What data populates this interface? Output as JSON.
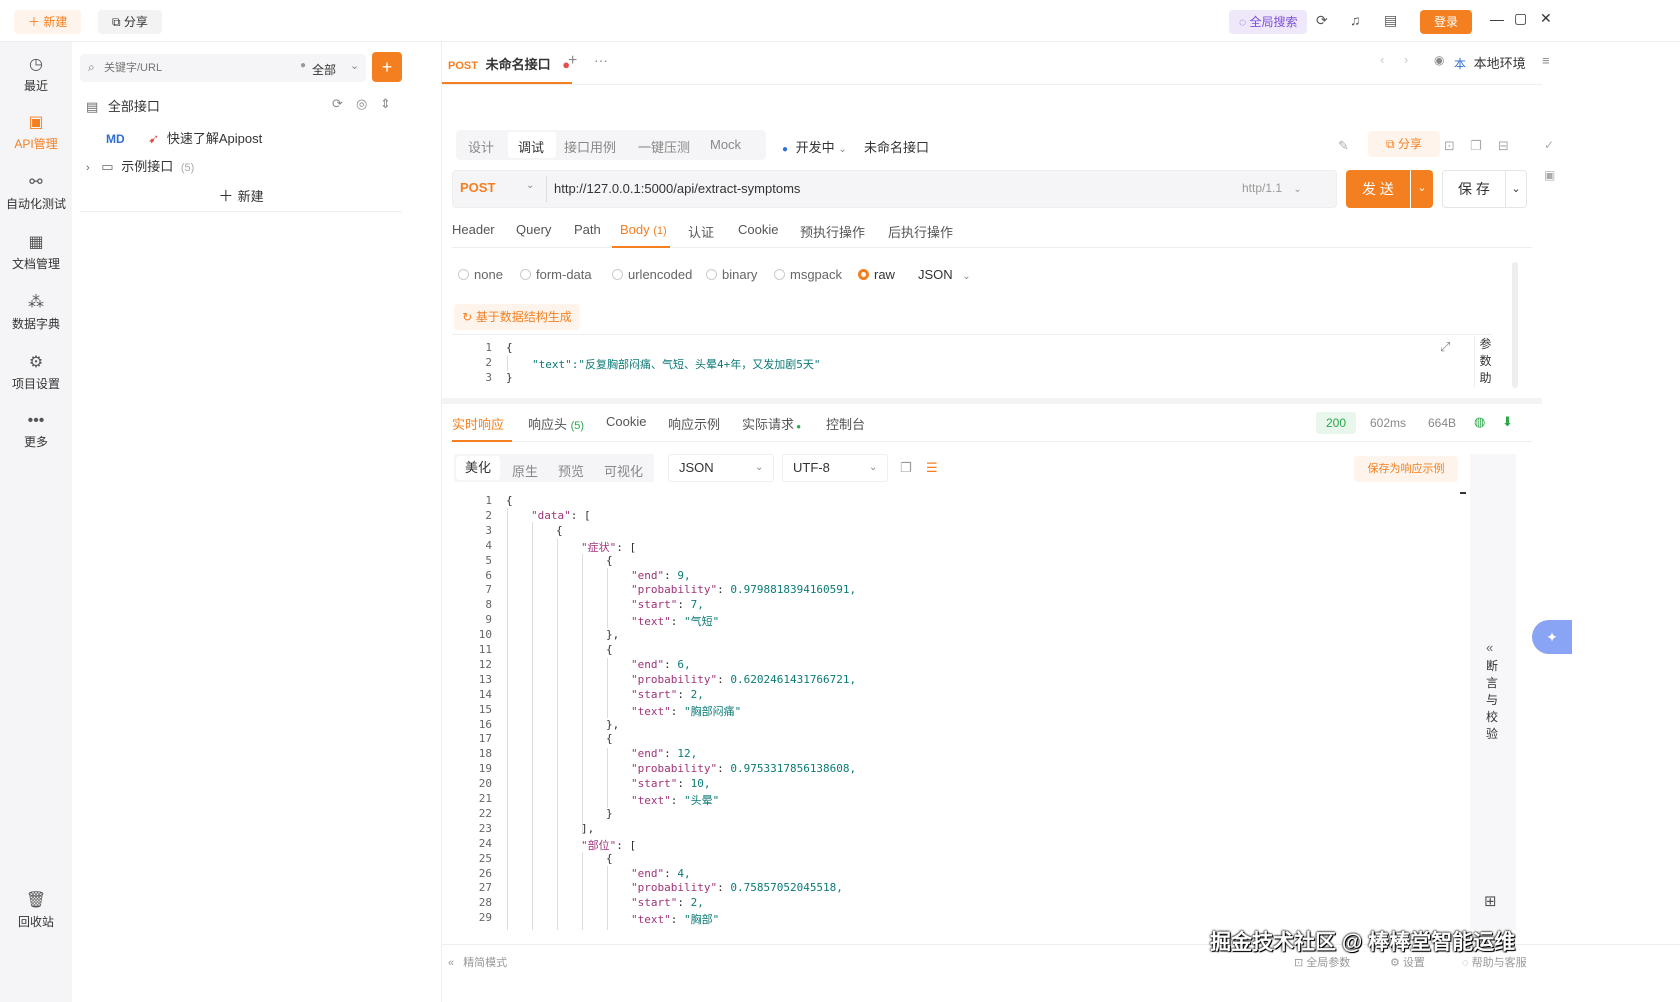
{
  "topbar": {
    "new": "新建",
    "share": "分享",
    "global_search": "全局搜索",
    "login": "登录"
  },
  "nav": {
    "items": [
      "最近",
      "API管理",
      "自动化测试",
      "文档管理",
      "数据字典",
      "项目设置",
      "更多"
    ],
    "trash": "回收站"
  },
  "sidebar": {
    "search_placeholder": "关键字/URL",
    "filter": "全部",
    "root": "全部接口",
    "md_badge": "MD",
    "quick": "快速了解Apipost",
    "example": "示例接口",
    "example_count": "(5)",
    "new": "新建"
  },
  "tabbar": {
    "method": "POST",
    "name": "未命名接口",
    "env": "本地环境",
    "env_badge": "本"
  },
  "modes": {
    "items": [
      "设计",
      "调试",
      "接口用例",
      "一键压测",
      "Mock"
    ],
    "status": "开发中",
    "title": "未命名接口",
    "share": "分享"
  },
  "request": {
    "method": "POST",
    "url": "http://127.0.0.1:5000/api/extract-symptoms",
    "protocol": "http/1.1",
    "send": "发 送",
    "save": "保 存"
  },
  "req_tabs": {
    "items": [
      "Header",
      "Query",
      "Path",
      "Body",
      "认证",
      "Cookie",
      "预执行操作",
      "后执行操作"
    ],
    "body_count": "(1)"
  },
  "body_types": {
    "items": [
      "none",
      "form-data",
      "urlencoded",
      "binary",
      "msgpack",
      "raw"
    ],
    "format": "JSON",
    "generate": "基于数据结构生成",
    "side": [
      "参",
      "数",
      "助"
    ]
  },
  "body_code": {
    "lines": [
      "{",
      "\"text\":\"反复胸部闷痛、气短、头晕4+年，又发加剧5天\"",
      "}"
    ]
  },
  "resp_tabs": {
    "items": [
      "实时响应",
      "响应头",
      "Cookie",
      "响应示例",
      "实际请求",
      "控制台"
    ],
    "header_count": "(5)",
    "status": "200",
    "time": "602ms",
    "size": "664B"
  },
  "resp_view": {
    "items": [
      "美化",
      "原生",
      "预览",
      "可视化"
    ],
    "format": "JSON",
    "encoding": "UTF-8",
    "save_example": "保存为响应示例"
  },
  "assert": [
    "断",
    "言",
    "与",
    "校",
    "验"
  ],
  "footer": {
    "mode": "精简模式",
    "global": "全局参数",
    "settings": "设置",
    "help": "帮助与客服",
    "watermark": "掘金技术社区 @ 棒棒堂智能运维"
  }
}
